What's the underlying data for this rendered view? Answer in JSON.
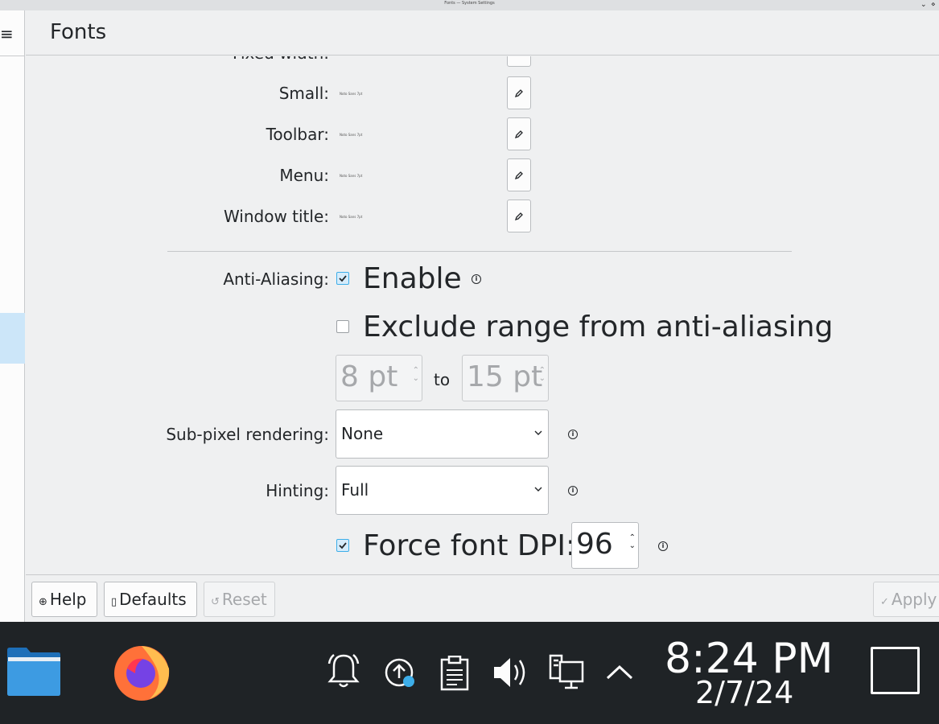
{
  "window": {
    "title": "Fonts — System Settings",
    "minimize_glyph": "⌄",
    "close_glyph": "⋄"
  },
  "sidebar": {
    "menu_glyph": "≡"
  },
  "header": {
    "title": "Fonts"
  },
  "fonts": {
    "fixed_width": {
      "label": "Fixed width:"
    },
    "small": {
      "label": "Small:",
      "preview": "Noto Sans 7pt"
    },
    "toolbar": {
      "label": "Toolbar:",
      "preview": "Noto Sans 7pt"
    },
    "menu": {
      "label": "Menu:",
      "preview": "Noto Sans 7pt"
    },
    "window_title": {
      "label": "Window title:",
      "preview": "Noto Sans 7pt"
    }
  },
  "antialiasing": {
    "label": "Anti-Aliasing:",
    "enable_label": "Enable",
    "enable_checked": true,
    "exclude_label": "Exclude range from anti-aliasing",
    "exclude_checked": false,
    "range_from": "8 pt",
    "range_to_label": "to",
    "range_to": "15 pt"
  },
  "subpixel": {
    "label": "Sub-pixel rendering:",
    "value": "None"
  },
  "hinting": {
    "label": "Hinting:",
    "value": "Full"
  },
  "dpi": {
    "label": "Force font DPI:",
    "checked": true,
    "value": "96"
  },
  "info_glyph": "i",
  "footer": {
    "help_label": "Help",
    "defaults_label": "Defaults",
    "reset_label": "Reset",
    "apply_label": "Apply"
  },
  "taskbar": {
    "time": "8:24 PM",
    "date": "2/7/24",
    "apps": [
      "file-manager",
      "firefox"
    ],
    "tray": [
      "notifications",
      "updates",
      "clipboard",
      "volume",
      "network",
      "expand-tray"
    ]
  },
  "colors": {
    "accent": "#3daee9",
    "taskbar_bg": "#1f2326",
    "window_bg": "#eff0f1",
    "selection": "#cce6f9"
  }
}
